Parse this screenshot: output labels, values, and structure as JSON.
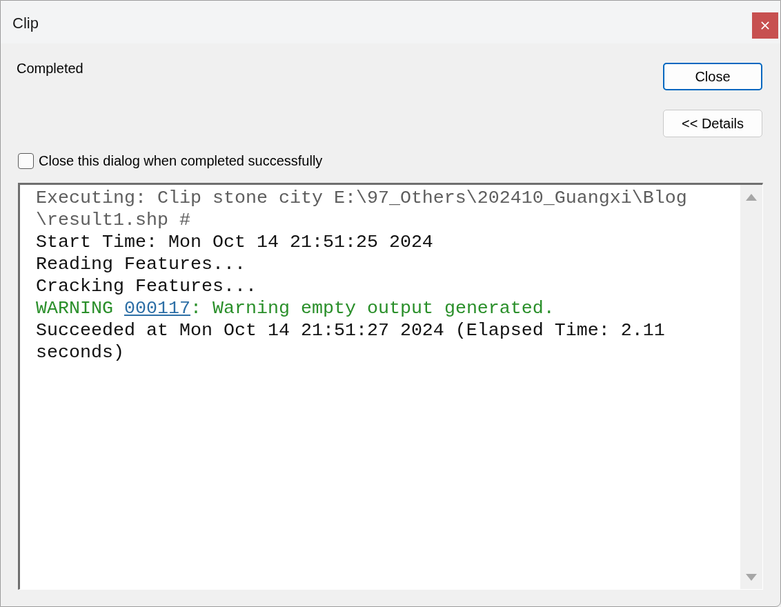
{
  "window": {
    "title": "Clip"
  },
  "status": {
    "text": "Completed"
  },
  "close_button": {
    "label": "Close",
    "default": true
  },
  "details_button": {
    "label": "<< Details",
    "default": false
  },
  "close_option": {
    "label": "Close this dialog when completed successfully",
    "checked": false
  },
  "log": {
    "messages": [
      {
        "kind": "command",
        "lines": [
          "Executing: Clip stone city E:\\97_Others\\202410_Guangxi\\Blog",
          "\\result1.shp #"
        ]
      },
      {
        "kind": "info",
        "lines": [
          "Start Time: Mon Oct 14 21:51:25 2024"
        ]
      },
      {
        "kind": "info",
        "lines": [
          "Reading Features..."
        ]
      },
      {
        "kind": "info",
        "lines": [
          "Cracking Features..."
        ]
      },
      {
        "kind": "warning",
        "prefix": "WARNING",
        "code": "000117",
        "text": ": Warning empty output generated."
      },
      {
        "kind": "info",
        "lines": [
          "Succeeded at Mon Oct 14 21:51:27 2024 (Elapsed Time: 2.11",
          "seconds)"
        ]
      }
    ]
  }
}
